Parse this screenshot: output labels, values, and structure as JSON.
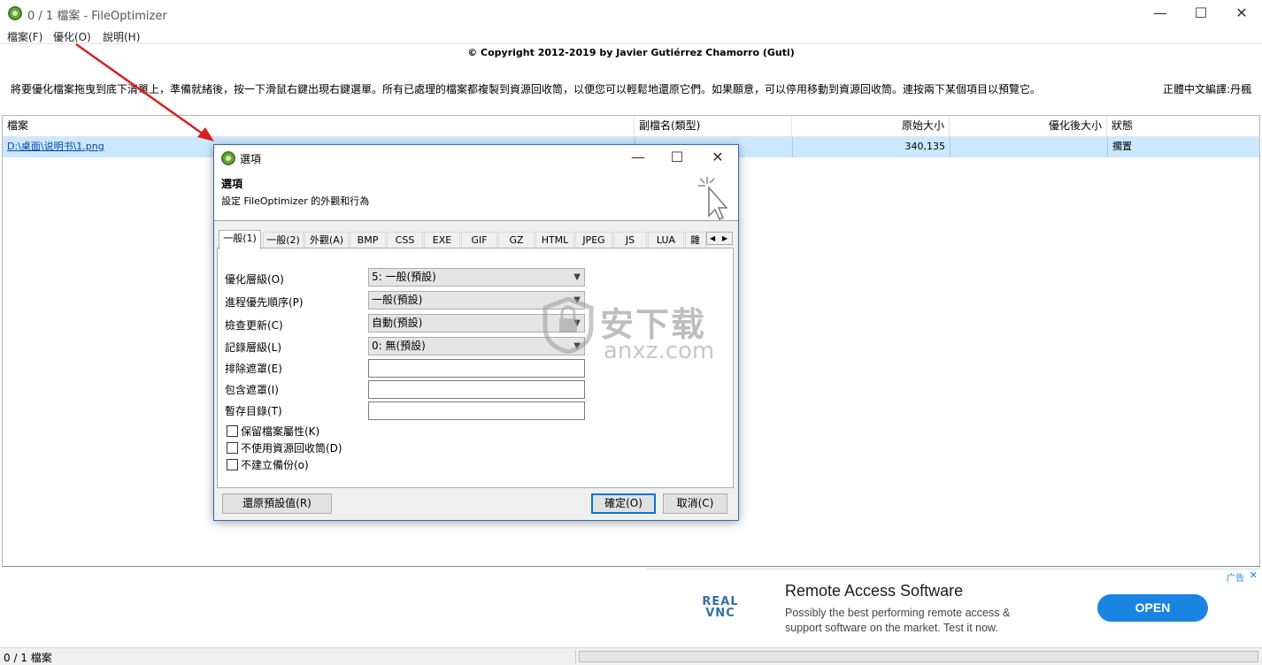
{
  "window": {
    "title": "0 / 1 檔案 - FileOptimizer",
    "minimize": "—",
    "maximize": "☐",
    "close": "✕"
  },
  "menu": [
    "檔案(F)",
    "優化(O)",
    "說明(H)"
  ],
  "copyright": "© Copyright 2012-2019 by Javier Gutiérrez Chamorro (Guti)",
  "description": "將要優化檔案拖曳到底下清單上，準備就緒後，按一下滑鼠右鍵出現右鍵選單。所有已處理的檔案都複製到資源回收筒，以便您可以輕鬆地還原它們。如果願意，可以停用移動到資源回收筒。連按兩下某個項目以預覽它。",
  "credit": "正體中文編譯:丹楓",
  "list": {
    "columns": [
      "檔案",
      "副檔名(類型)",
      "原始大小",
      "優化後大小",
      "狀態"
    ],
    "rows": [
      {
        "file": "D:\\桌面\\说明书\\1.png",
        "ext": "",
        "orig": "340,135",
        "opt": "",
        "status": "擱置"
      }
    ]
  },
  "dialog": {
    "title": "選項",
    "header_title": "選項",
    "header_sub": "設定 FileOptimizer 的外觀和行為",
    "tabs": [
      "一般(1)",
      "一般(2)",
      "外觀(A)",
      "BMP",
      "CSS",
      "EXE",
      "GIF",
      "GZ",
      "HTML",
      "JPEG",
      "JS",
      "LUA",
      "雜項"
    ],
    "fields": {
      "opt_level_label": "優化層級(O)",
      "opt_level_value": "5: 一般(預設)",
      "priority_label": "進程優先順序(P)",
      "priority_value": "一般(預設)",
      "update_label": "檢查更新(C)",
      "update_value": "自動(預設)",
      "log_label": "記錄層級(L)",
      "log_value": "0: 無(預設)",
      "exclude_label": "排除遮罩(E)",
      "include_label": "包含遮罩(I)",
      "temp_label": "暫存目錄(T)"
    },
    "checkboxes": [
      "保留檔案屬性(K)",
      "不使用資源回收筒(D)",
      "不建立備份(o)"
    ],
    "buttons": {
      "restore": "還原預設值(R)",
      "ok": "確定(O)",
      "cancel": "取消(C)"
    }
  },
  "watermark": {
    "cn": "安下载",
    "en": "anxz.com"
  },
  "ad": {
    "logo": "REAL VNC",
    "tag": "广告",
    "close": "✕",
    "title": "Remote Access Software",
    "body": "Possibly the best performing remote access & support software on the market. Test it now.",
    "cta": "OPEN"
  },
  "status": "0 / 1 檔案",
  "colors": {
    "selection": "#cce8ff",
    "accent": "#0078d7",
    "cta": "#1a84e3",
    "arrow": "#d6201f"
  }
}
